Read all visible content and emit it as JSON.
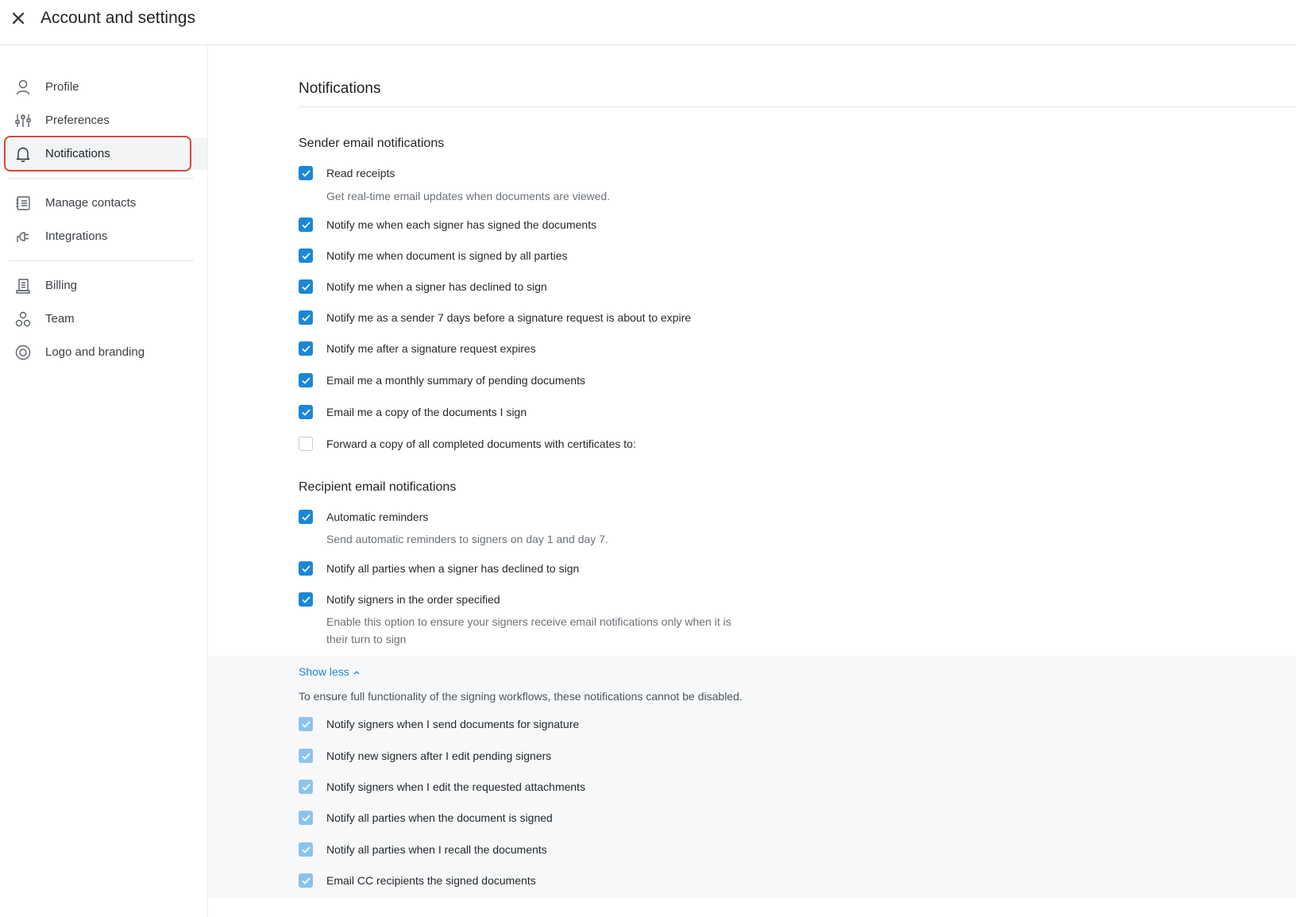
{
  "header": {
    "title": "Account and settings",
    "close_icon": "close-icon"
  },
  "sidebar": {
    "items": [
      {
        "label": "Profile",
        "icon": "user-icon"
      },
      {
        "label": "Preferences",
        "icon": "sliders-icon"
      },
      {
        "label": "Notifications",
        "icon": "bell-icon",
        "active": true
      },
      {
        "label": "Manage contacts",
        "icon": "contacts-icon"
      },
      {
        "label": "Integrations",
        "icon": "plug-icon"
      },
      {
        "label": "Billing",
        "icon": "receipt-icon"
      },
      {
        "label": "Team",
        "icon": "team-icon"
      },
      {
        "label": "Logo and branding",
        "icon": "branding-icon"
      }
    ]
  },
  "main": {
    "title": "Notifications",
    "sender": {
      "heading": "Sender email notifications",
      "options": [
        {
          "label": "Read receipts",
          "checked": true,
          "description": "Get real-time email updates when documents are viewed."
        },
        {
          "label": "Notify me when each signer has signed the documents",
          "checked": true
        },
        {
          "label": "Notify me when document is signed by all parties",
          "checked": true
        },
        {
          "label": "Notify me when a signer has declined to sign",
          "checked": true
        },
        {
          "label": "Notify me as a sender 7 days before a signature request is about to expire",
          "checked": true
        },
        {
          "label": "Notify me after a signature request expires",
          "checked": true
        },
        {
          "label": "Email me a monthly summary of pending documents",
          "checked": true
        },
        {
          "label": "Email me a copy of the documents I sign",
          "checked": true
        },
        {
          "label": "Forward a copy of all completed documents with certificates to:",
          "checked": false
        }
      ]
    },
    "recipient": {
      "heading": "Recipient email notifications",
      "options": [
        {
          "label": "Automatic reminders",
          "checked": true,
          "description": "Send automatic reminders to signers on day 1 and day 7."
        },
        {
          "label": "Notify all parties when a signer has declined to sign",
          "checked": true
        },
        {
          "label": "Notify signers in the order specified",
          "checked": true,
          "description_line1": "Enable this option to ensure your signers receive email notifications only when it is",
          "description_line2": "their turn to sign"
        }
      ]
    },
    "locked": {
      "toggle_label": "Show less",
      "toggle_icon": "chevron-up-icon",
      "note": "To ensure full functionality of the signing workflows, these notifications cannot be disabled.",
      "options": [
        {
          "label": "Notify signers when I send documents for signature",
          "checked": true
        },
        {
          "label": "Notify new signers after I edit pending signers",
          "checked": true
        },
        {
          "label": "Notify signers when I edit the requested attachments",
          "checked": true
        },
        {
          "label": "Notify all parties when the document is signed",
          "checked": true
        },
        {
          "label": "Notify all parties when I recall the documents",
          "checked": true
        },
        {
          "label": "Email CC recipients the signed documents",
          "checked": true
        }
      ]
    }
  },
  "colors": {
    "accent": "#1a87d7",
    "active_outline": "#d9473b",
    "disabled_check": "#8cc3ec"
  }
}
